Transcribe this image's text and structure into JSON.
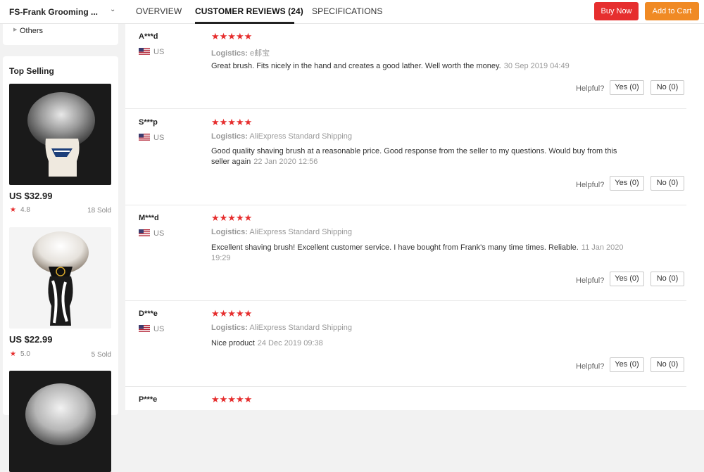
{
  "header": {
    "store_name": "FS-Frank Grooming ...",
    "tabs": [
      {
        "label": "OVERVIEW"
      },
      {
        "label": "CUSTOMER REVIEWS (24)"
      },
      {
        "label": "SPECIFICATIONS"
      }
    ],
    "buy_now_label": "Buy Now",
    "add_to_cart_label": "Add to Cart"
  },
  "sidebar": {
    "category_item": "Others",
    "top_selling_title": "Top Selling",
    "products": [
      {
        "price": "US $32.99",
        "rating": "4.8",
        "sold": "18 Sold"
      },
      {
        "price": "US $22.99",
        "rating": "5.0",
        "sold": "5 Sold"
      }
    ]
  },
  "reviews": [
    {
      "name": "A***d",
      "country": "US",
      "stars": "★★★★★",
      "logistics_label": "Logistics:",
      "logistics": "e邮宝",
      "text": "Great brush. Fits nicely in the hand and creates a good lather. Well worth the money.",
      "date": "30 Sep 2019 04:49",
      "helpful": "Helpful?",
      "yes": "Yes (0)",
      "no": "No (0)"
    },
    {
      "name": "S***p",
      "country": "US",
      "stars": "★★★★★",
      "logistics_label": "Logistics:",
      "logistics": "AliExpress Standard Shipping",
      "text": "Good quality shaving brush at a reasonable price. Good response from the seller to my questions. Would buy from this seller again",
      "date": "22 Jan 2020 12:56",
      "helpful": "Helpful?",
      "yes": "Yes (0)",
      "no": "No (0)"
    },
    {
      "name": "M***d",
      "country": "US",
      "stars": "★★★★★",
      "logistics_label": "Logistics:",
      "logistics": "AliExpress Standard Shipping",
      "text": "Excellent shaving brush! Excellent customer service. I have bought from Frank's many time times. Reliable.",
      "date": "11 Jan 2020 19:29",
      "helpful": "Helpful?",
      "yes": "Yes (0)",
      "no": "No (0)"
    },
    {
      "name": "D***e",
      "country": "US",
      "stars": "★★★★★",
      "logistics_label": "Logistics:",
      "logistics": "AliExpress Standard Shipping",
      "text": "Nice product",
      "date": "24 Dec 2019 09:38",
      "helpful": "Helpful?",
      "yes": "Yes (0)",
      "no": "No (0)"
    },
    {
      "name": "P***e",
      "stars": "★★★★★"
    }
  ],
  "icons": {
    "star": "star-icon",
    "flag": "us-flag-icon",
    "chevron": "chevron-down-icon",
    "caret": "caret-right-icon"
  },
  "colors": {
    "accent_red": "#e62e2e",
    "add_to_cart_orange": "#f08a24"
  }
}
